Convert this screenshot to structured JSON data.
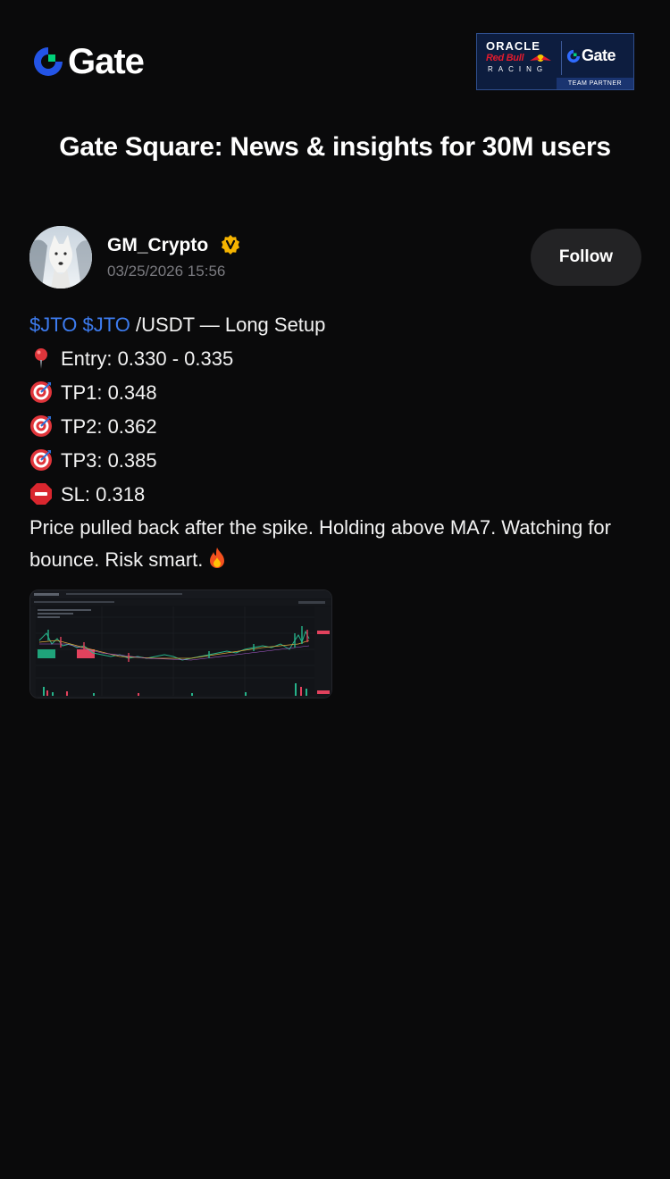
{
  "brand": {
    "logo_text": "Gate"
  },
  "partner": {
    "oracle": "ORACLE",
    "redbull": "Red Bull",
    "racing": "RACING",
    "gate": "Gate",
    "badge": "TEAM PARTNER"
  },
  "headline": "Gate Square: News & insights for 30M users",
  "post": {
    "author": "GM_Crypto",
    "verified_badge": "V",
    "timestamp": "03/25/2026 15:56",
    "follow_label": "Follow",
    "tag1": "$JTO",
    "tag2": "$JTO",
    "title_rest": " /USDT — Long Setup",
    "entry": "Entry: 0.330 - 0.335",
    "tp1": "TP1: 0.348",
    "tp2": "TP2: 0.362",
    "tp3": "TP3: 0.385",
    "sl": "SL: 0.318",
    "paragraph": "Price pulled back after the spike. Holding above MA7. Watching for bounce. Risk smart."
  },
  "icons": {
    "entry": "round-pushpin-icon",
    "targets": "direct-hit-icon",
    "stop": "stop-sign-icon",
    "fire": "fire-icon"
  },
  "colors": {
    "background": "#0a0a0b",
    "tag": "#3d7cf0",
    "follow_bg": "#232325",
    "timestamp": "#7b7b80",
    "gate_green": "#00d27a",
    "gate_blue": "#2354e6",
    "verified": "#f5b400"
  }
}
